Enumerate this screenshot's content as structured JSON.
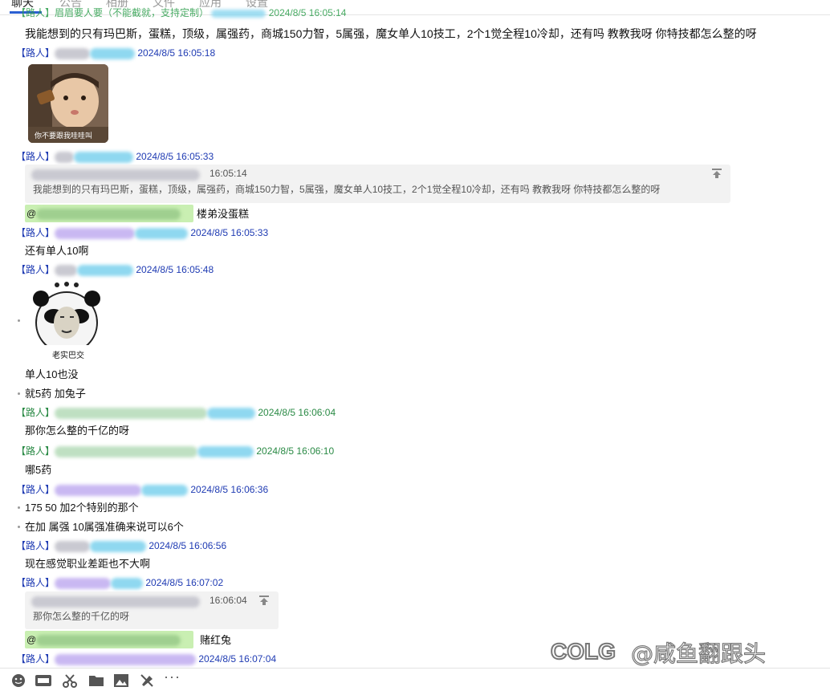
{
  "tabs": [
    {
      "label": "聊天"
    },
    {
      "label": "公告"
    },
    {
      "label": "相册"
    },
    {
      "label": "文件"
    },
    {
      "label": "应用"
    },
    {
      "label": "设置"
    }
  ],
  "top_partial": {
    "tag": "【路人】",
    "name": "眉眉要人要（不能截就，支持定制）",
    "time": "2024/8/5 16:05:14"
  },
  "messages": {
    "m1_text": "我能想到的只有玛巴斯，蛋糕，顶级，属强药，商城150力智，5属强，魔女单人10技工，2个1觉全程10冷却，还有吗  教教我呀  你特技都怎么整的呀",
    "h2": {
      "tag": "【路人】",
      "time": "2024/8/5 16:05:18"
    },
    "sticker1_caption": "你不要跟我哇哇叫",
    "h3": {
      "tag": "【路人】",
      "time": "2024/8/5 16:05:33"
    },
    "quote1": {
      "time": "16:05:14",
      "text": "我能想到的只有玛巴斯，蛋糕，顶级，属强药，商城150力智，5属强，魔女单人10技工，2个1觉全程10冷却，还有吗  教教我呀  你特技都怎么整的呀"
    },
    "reply1": {
      "mention": "@",
      "text": "楼弟没蛋糕"
    },
    "h4": {
      "tag": "【路人】",
      "time": "2024/8/5 16:05:33"
    },
    "m4_text": "还有单人10啊",
    "h5": {
      "tag": "【路人】",
      "time": "2024/8/5 16:05:48"
    },
    "sticker2_caption": "老实巴交",
    "m5_text1": "单人10也没",
    "m5_text2": "就5药 加兔子",
    "h6": {
      "tag": "【路人】",
      "time": "2024/8/5 16:06:04"
    },
    "m6_text": "那你怎么整的千亿的呀",
    "h7": {
      "tag": "【路人】",
      "time": "2024/8/5 16:06:10"
    },
    "m7_text": "哪5药",
    "h8": {
      "tag": "【路人】",
      "time": "2024/8/5 16:06:36"
    },
    "m8_text1": "175 50  加2个特别的那个",
    "m8_text2": "在加 属强  10属强准确来说可以6个",
    "h9": {
      "tag": "【路人】",
      "time": "2024/8/5 16:06:56"
    },
    "m9_text": "现在感觉职业差距也不大啊",
    "h10": {
      "tag": "【路人】",
      "time": "2024/8/5 16:07:02"
    },
    "quote2": {
      "time": "16:06:04",
      "text": "那你怎么整的千亿的呀"
    },
    "reply2": {
      "mention": "@",
      "text": "赌红兔"
    },
    "h11": {
      "tag": "【路人】",
      "time": "2024/8/5 16:07:04"
    }
  },
  "toolbar_more": "···",
  "watermark_text": "@咸鱼翻跟头",
  "watermark_logo": "COLG",
  "colors": {
    "blue_header": "#1f3bb3",
    "green_header": "#2a8a45",
    "mention_bg": "#c9efb2",
    "quote_bg": "#f2f2f2"
  }
}
